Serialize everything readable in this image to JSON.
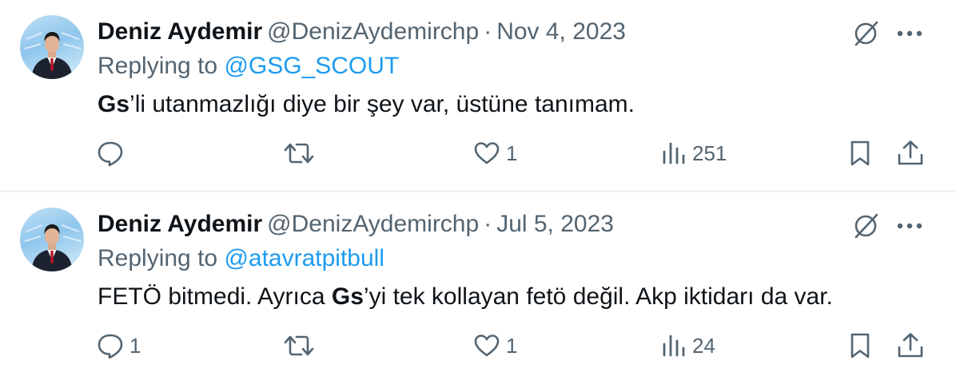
{
  "tweets": [
    {
      "author_name": "Deniz Aydemir",
      "handle": "@DenizAydemirchp",
      "separator": "·",
      "date": "Nov 4, 2023",
      "replying_prefix": "Replying to",
      "replying_to": "@GSG_SCOUT",
      "text_bold": "Gs",
      "text_rest": "’li utanmazlığı diye bir şey var, üstüne tanımam.",
      "text_pre": "",
      "replies": "",
      "retweets": "",
      "likes": "1",
      "views": "251"
    },
    {
      "author_name": "Deniz Aydemir",
      "handle": "@DenizAydemirchp",
      "separator": "·",
      "date": "Jul 5, 2023",
      "replying_prefix": "Replying to",
      "replying_to": "@atavratpitbull",
      "text_pre": "FETÖ bitmedi. Ayrıca ",
      "text_bold": "Gs",
      "text_rest": "’yi tek kollayan fetö değil. Akp iktidarı da var.",
      "replies": "1",
      "retweets": "",
      "likes": "1",
      "views": "24"
    }
  ],
  "colors": {
    "text": "#0f1419",
    "secondary": "#536471",
    "link": "#1d9bf0",
    "divider": "#eff3f4"
  },
  "icons": [
    "grok-icon",
    "more-icon",
    "reply-icon",
    "retweet-icon",
    "like-icon",
    "views-icon",
    "bookmark-icon",
    "share-icon"
  ]
}
